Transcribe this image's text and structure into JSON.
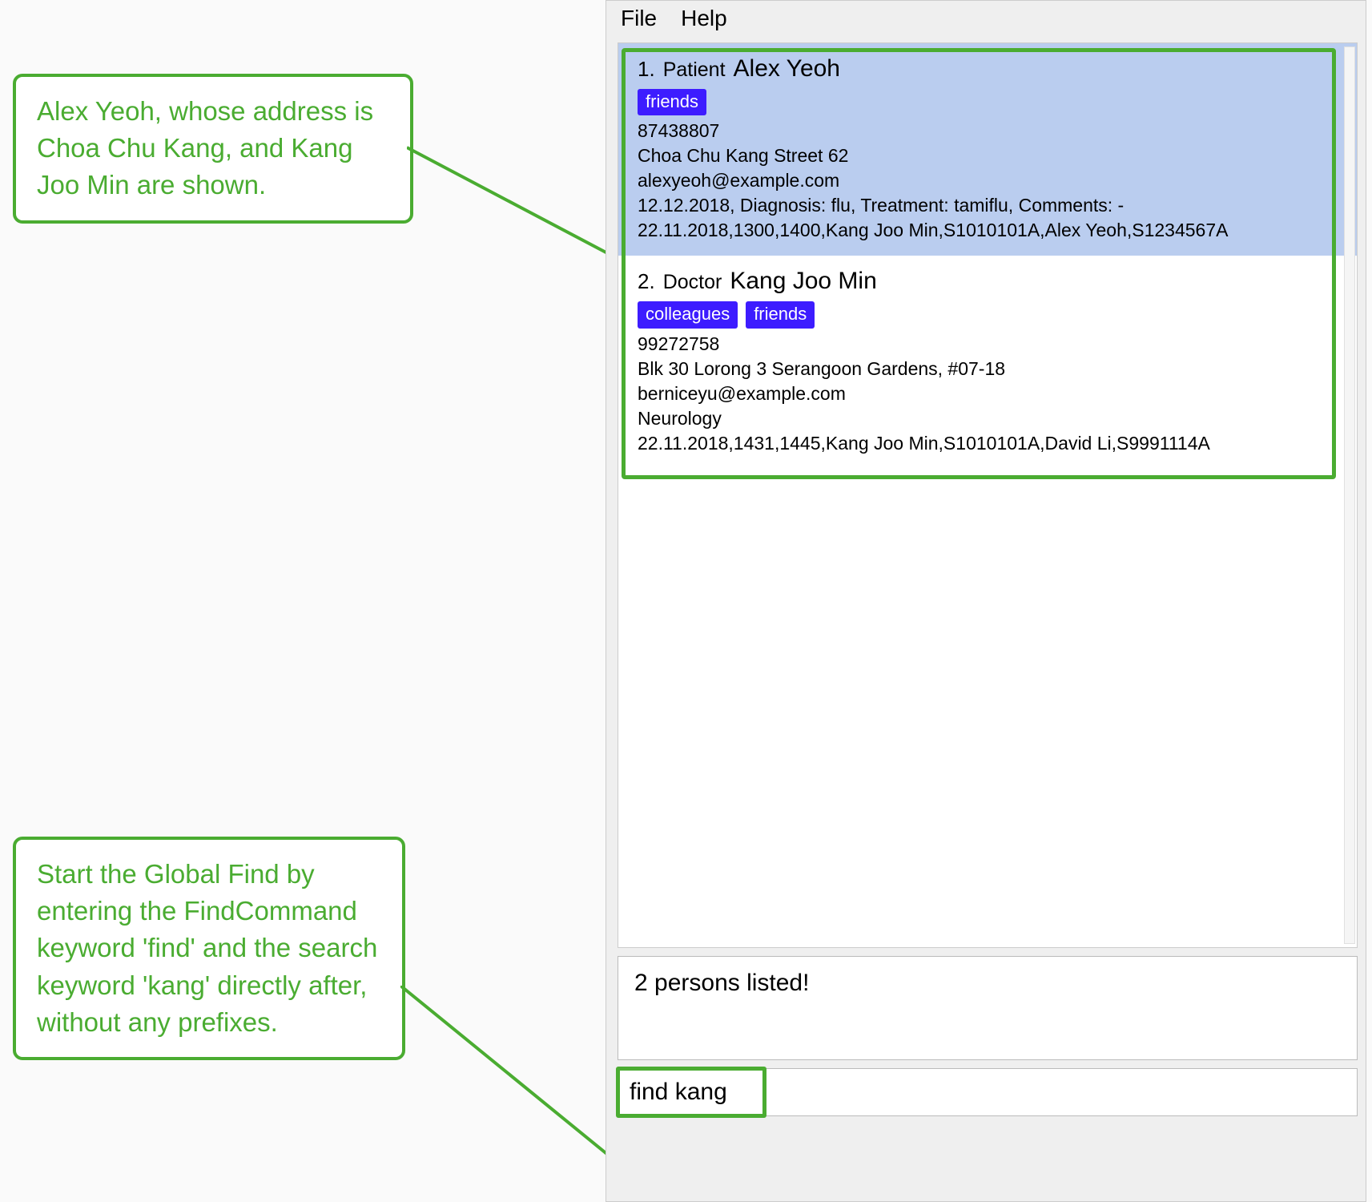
{
  "menubar": {
    "file": "File",
    "help": "Help"
  },
  "callouts": {
    "results": "Alex Yeoh, whose address is Choa Chu Kang, and Kang Joo Min are shown.",
    "command": "Start the Global Find by entering the FindCommand keyword 'find' and the search keyword 'kang' directly after, without any prefixes."
  },
  "persons": [
    {
      "index": "1.",
      "role": "Patient",
      "name": "Alex Yeoh",
      "tags": [
        "friends"
      ],
      "phone": "87438807",
      "address": "Choa Chu Kang Street 62",
      "email": "alexyeoh@example.com",
      "extra1": "12.12.2018, Diagnosis: flu, Treatment: tamiflu, Comments: -",
      "extra2": "22.11.2018,1300,1400,Kang Joo Min,S1010101A,Alex Yeoh,S1234567A",
      "selected": true
    },
    {
      "index": "2.",
      "role": "Doctor",
      "name": "Kang Joo Min",
      "tags": [
        "colleagues",
        "friends"
      ],
      "phone": "99272758",
      "address": "Blk 30 Lorong 3 Serangoon Gardens, #07-18",
      "email": "berniceyu@example.com",
      "extra1": "Neurology",
      "extra2": "22.11.2018,1431,1445,Kang Joo Min,S1010101A,David Li,S9991114A",
      "selected": false
    }
  ],
  "status": "2 persons listed!",
  "command_input": "find kang"
}
